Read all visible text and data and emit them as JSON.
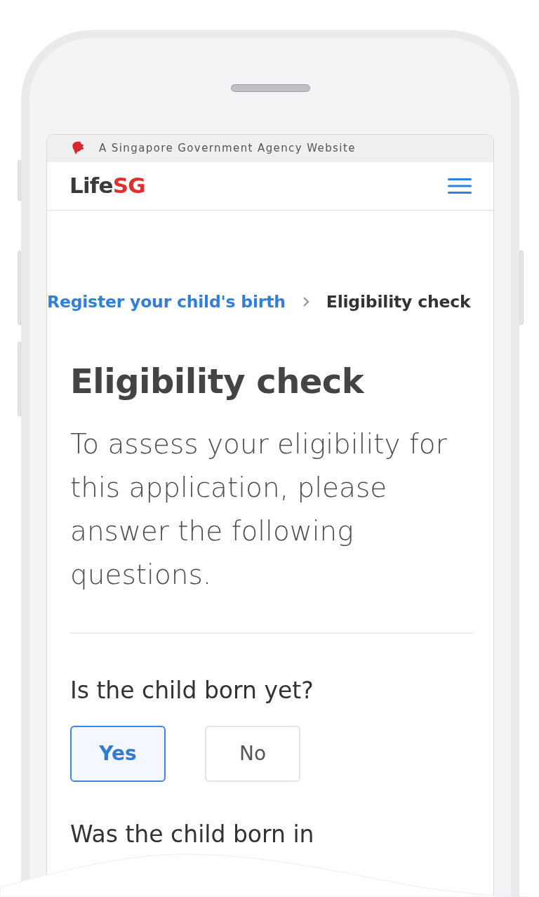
{
  "gov_banner": {
    "text": "A Singapore Government Agency Website"
  },
  "header": {
    "logo": {
      "text": "Life",
      "accent": "SG"
    }
  },
  "breadcrumb": [
    {
      "label": "Register your child's birth",
      "kind": "link"
    },
    {
      "label": "Eligibility check",
      "kind": "current"
    }
  ],
  "title": "Eligibility check",
  "intro": "To assess your eligibility for this application, please answer the following questions.",
  "questions": [
    {
      "text": "Is the child born yet?",
      "options": [
        {
          "label": "Yes",
          "selected": true
        },
        {
          "label": "No",
          "selected": false
        }
      ]
    },
    {
      "text": "Was the child born in"
    }
  ]
}
